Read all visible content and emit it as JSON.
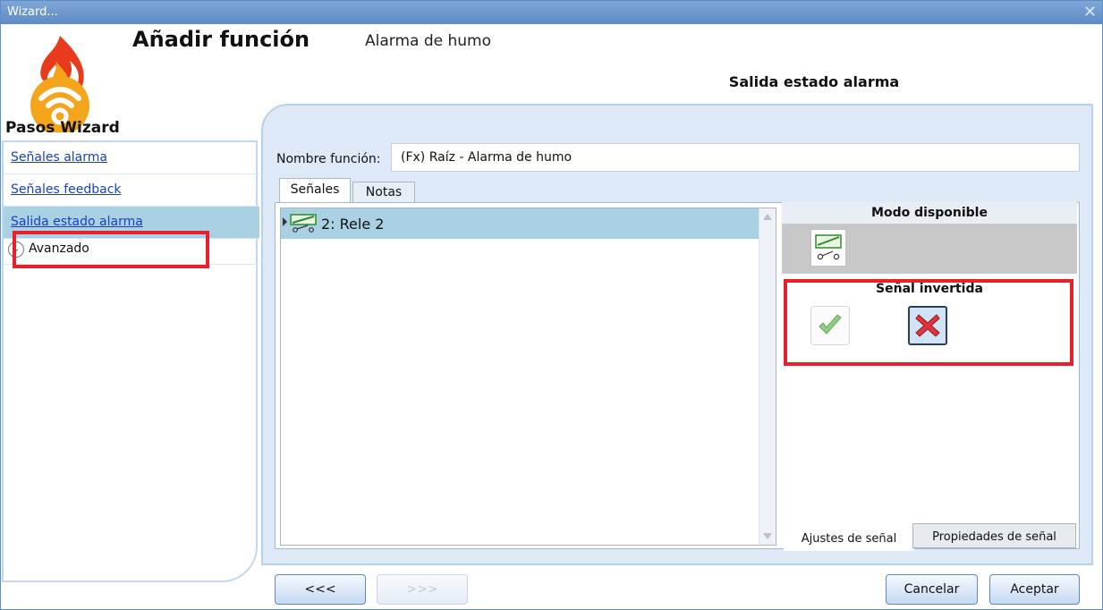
{
  "window": {
    "title": "Wizard...",
    "close_glyph": "✕"
  },
  "header": {
    "title": "Añadir función",
    "subtitle": "Alarma de humo"
  },
  "step_tab": {
    "label": "Salida estado alarma"
  },
  "sidebar": {
    "title": "Pasos Wizard",
    "items": [
      {
        "label": "Señales alarma",
        "selected": false
      },
      {
        "label": "Señales feedback",
        "selected": false
      },
      {
        "label": "Salida estado alarma",
        "selected": true
      }
    ],
    "advanced": {
      "label": "Avanzado",
      "icon": "chevron-down-icon"
    }
  },
  "function_name": {
    "label": "Nombre función:",
    "value": "(Fx) Raíz - Alarma de humo"
  },
  "tabs": [
    {
      "label": "Señales",
      "active": true
    },
    {
      "label": "Notas",
      "active": false
    }
  ],
  "signals": [
    {
      "label": "2: Rele 2",
      "icon": "relay-icon",
      "selected": true
    }
  ],
  "properties": {
    "mode_title": "Modo disponible",
    "inverted_title": "Señal invertida"
  },
  "subtabs": [
    {
      "label": "Ajustes de señal",
      "active": true
    },
    {
      "label": "Propiedades de señal",
      "active": false
    }
  ],
  "footer": {
    "back_label": "<<<",
    "next_label": ">>>",
    "cancel_label": "Cancelar",
    "accept_label": "Aceptar"
  },
  "colors": {
    "highlight_red": "#e8202b",
    "selection_blue": "#a9d1e3",
    "titlebar": "#6d98cd",
    "link": "#1a3fc2"
  }
}
